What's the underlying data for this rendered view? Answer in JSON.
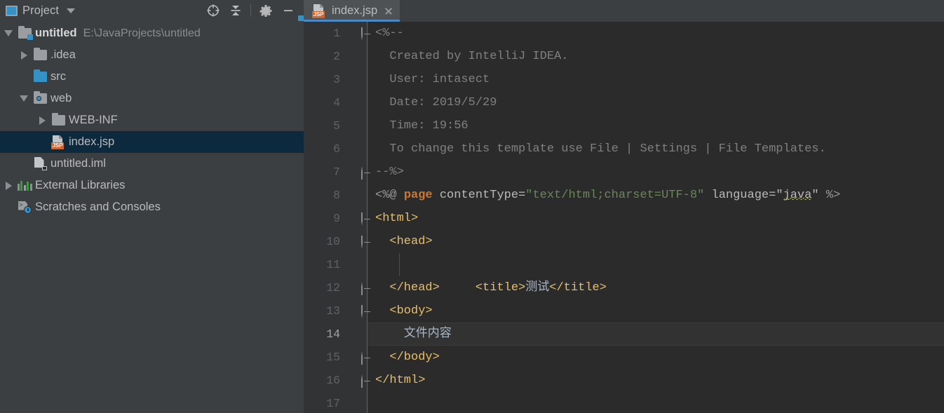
{
  "tool_window": {
    "title": "Project",
    "icons": {
      "window": "project-window-icon",
      "caret": "chevron-down-icon",
      "locate": "locate-target-icon",
      "collapse_all": "collapse-all-icon",
      "settings": "gear-icon",
      "hide": "minimize-icon"
    }
  },
  "tree": {
    "nodes": [
      {
        "label": "untitled",
        "secondary": "E:\\JavaProjects\\untitled",
        "icon": "module-folder-icon",
        "toggle": "expanded",
        "depth": 0,
        "bold": true,
        "selected": false
      },
      {
        "label": ".idea",
        "secondary": "",
        "icon": "folder-icon",
        "toggle": "collapsed",
        "depth": 1,
        "bold": false,
        "selected": false
      },
      {
        "label": "src",
        "secondary": "",
        "icon": "source-folder-icon",
        "toggle": "none",
        "depth": 1,
        "bold": false,
        "selected": false
      },
      {
        "label": "web",
        "secondary": "",
        "icon": "web-folder-icon",
        "toggle": "expanded",
        "depth": 1,
        "bold": false,
        "selected": false
      },
      {
        "label": "WEB-INF",
        "secondary": "",
        "icon": "folder-icon",
        "toggle": "collapsed",
        "depth": 2,
        "bold": false,
        "selected": false
      },
      {
        "label": "index.jsp",
        "secondary": "",
        "icon": "jsp-file-icon",
        "toggle": "none",
        "depth": 2,
        "bold": false,
        "selected": true
      },
      {
        "label": "untitled.iml",
        "secondary": "",
        "icon": "iml-file-icon",
        "toggle": "none",
        "depth": 1,
        "bold": false,
        "selected": false
      },
      {
        "label": "External Libraries",
        "secondary": "",
        "icon": "libraries-icon",
        "toggle": "collapsed",
        "depth": 0,
        "bold": false,
        "selected": false
      },
      {
        "label": "Scratches and Consoles",
        "secondary": "",
        "icon": "scratches-icon",
        "toggle": "none",
        "depth": 0,
        "bold": false,
        "selected": false
      }
    ]
  },
  "editor": {
    "tab": {
      "label": "index.jsp",
      "icon": "jsp-file-icon",
      "close": "close-icon",
      "active": true
    },
    "current_line": 14,
    "lines": [
      {
        "n": 1,
        "fold": "open",
        "indent_guide": false
      },
      {
        "n": 2,
        "fold": "none",
        "indent_guide": false
      },
      {
        "n": 3,
        "fold": "none",
        "indent_guide": false
      },
      {
        "n": 4,
        "fold": "none",
        "indent_guide": false
      },
      {
        "n": 5,
        "fold": "none",
        "indent_guide": false
      },
      {
        "n": 6,
        "fold": "none",
        "indent_guide": false
      },
      {
        "n": 7,
        "fold": "close",
        "indent_guide": false
      },
      {
        "n": 8,
        "fold": "none",
        "indent_guide": false
      },
      {
        "n": 9,
        "fold": "open",
        "indent_guide": false
      },
      {
        "n": 10,
        "fold": "open",
        "indent_guide": false
      },
      {
        "n": 11,
        "fold": "none",
        "indent_guide": true
      },
      {
        "n": 12,
        "fold": "close",
        "indent_guide": false
      },
      {
        "n": 13,
        "fold": "open",
        "indent_guide": false
      },
      {
        "n": 14,
        "fold": "none",
        "indent_guide": false
      },
      {
        "n": 15,
        "fold": "close",
        "indent_guide": false
      },
      {
        "n": 16,
        "fold": "close",
        "indent_guide": false
      },
      {
        "n": 17,
        "fold": "none",
        "indent_guide": false
      }
    ],
    "code": {
      "l1": "<%--",
      "l2": "  Created by IntelliJ IDEA.",
      "l3": "  User: intasect",
      "l4": "  Date: 2019/5/29",
      "l5": "  Time: 19:56",
      "l6": "  To change this template use File | Settings | File Templates.",
      "l7": "--%>",
      "l8_open": "<%@ ",
      "l8_kw": "page",
      "l8_attr1": " contentType=",
      "l8_val1": "\"text/html;charset=UTF-8\"",
      "l8_attr2": " language=",
      "l8_val2q1": "\"",
      "l8_val2": "java",
      "l8_val2q2": "\"",
      "l8_close": " %>",
      "l9": "<html>",
      "l10": "  <head>",
      "l11_open": "    <title>",
      "l11_text": "测试",
      "l11_close": "</title>",
      "l12": "  </head>",
      "l13": "  <body>",
      "l14": "    文件内容",
      "l15": "  </body>",
      "l16": "</html>",
      "l17": ""
    }
  },
  "colors": {
    "panel_bg": "#3c3f41",
    "editor_bg": "#2b2b2b",
    "gutter_bg": "#313335",
    "selection": "#0d293e",
    "accent": "#3592c4",
    "tab_underline": "#4a88c7",
    "tag": "#e8bf6a",
    "string": "#6a8759",
    "keyword": "#cc7832",
    "comment": "#808080",
    "text": "#a9b7c6",
    "jsp_bracket": "#9876aa"
  }
}
